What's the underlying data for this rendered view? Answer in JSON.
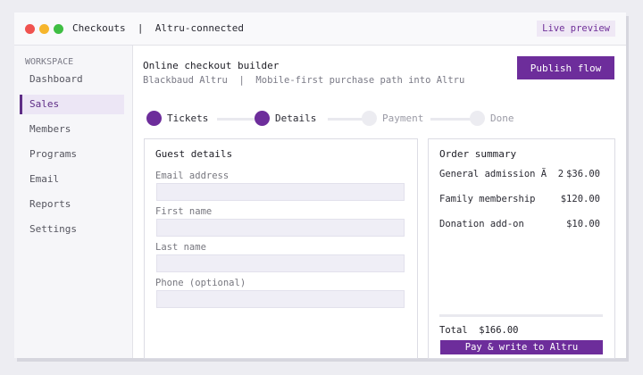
{
  "window": {
    "title": "Checkouts  |  Altru-connected",
    "live_preview": "Live preview"
  },
  "sidebar": {
    "section_label": "WORKSPACE",
    "items": [
      {
        "label": "Dashboard"
      },
      {
        "label": "Sales",
        "active": true
      },
      {
        "label": "Members"
      },
      {
        "label": "Programs"
      },
      {
        "label": "Email"
      },
      {
        "label": "Reports"
      },
      {
        "label": "Settings"
      }
    ]
  },
  "header": {
    "title": "Online checkout builder",
    "subtitle": "Blackbaud Altru  |  Mobile-first purchase path into Altru",
    "publish_label": "Publish flow"
  },
  "stepper": {
    "steps": [
      {
        "label": "Tickets",
        "done": true
      },
      {
        "label": "Details",
        "done": true
      },
      {
        "label": "Payment",
        "done": false
      },
      {
        "label": "Done",
        "done": false
      }
    ]
  },
  "guest": {
    "title": "Guest details",
    "fields": [
      {
        "label": "Email address",
        "value": ""
      },
      {
        "label": "First name",
        "value": ""
      },
      {
        "label": "Last name",
        "value": ""
      },
      {
        "label": "Phone (optional)",
        "value": ""
      }
    ]
  },
  "order": {
    "title": "Order summary",
    "lines": [
      {
        "name": "General admission Ã  2",
        "amount": "$36.00"
      },
      {
        "name": "Family membership",
        "amount": "$120.00"
      },
      {
        "name": "Donation add-on",
        "amount": "$10.00"
      }
    ],
    "total": "Total  $166.00",
    "pay_label": "Pay & write to Altru"
  },
  "colors": {
    "accent": "#6d2d9b",
    "input_bg": "#efeef6"
  }
}
